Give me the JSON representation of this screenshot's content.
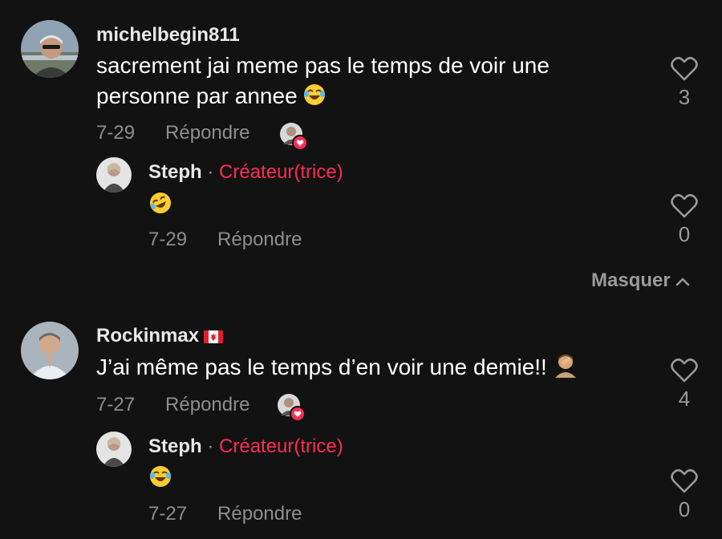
{
  "comments": [
    {
      "username": "michelbegin811",
      "text": "sacrement jai meme pas le temps de voir une personne par annee",
      "emoji": "face-with-tears-of-joy",
      "date": "7-29",
      "reply_label": "Répondre",
      "likes": "3",
      "reply": {
        "username": "Steph",
        "separator": "·",
        "badge": "Créateur(trice)",
        "emoji": "rolling-on-the-floor-laughing",
        "date": "7-29",
        "reply_label": "Répondre",
        "likes": "0"
      }
    },
    {
      "username": "Rockinmax",
      "flag": "canada-flag",
      "text": "J’ai même pas le temps d’en voir une demie!!",
      "emoji": "man-facepalming",
      "date": "7-27",
      "reply_label": "Répondre",
      "likes": "4",
      "reply": {
        "username": "Steph",
        "separator": "·",
        "badge": "Créateur(trice)",
        "emoji": "face-with-tears-of-joy",
        "date": "7-27",
        "reply_label": "Répondre",
        "likes": "0"
      }
    }
  ],
  "hide_replies_label": "Masquer",
  "colors": {
    "background": "#121212",
    "creator_badge": "#fe2c55",
    "secondary_text": "#8e8e8e",
    "liked_heart": "#fe2c55"
  }
}
